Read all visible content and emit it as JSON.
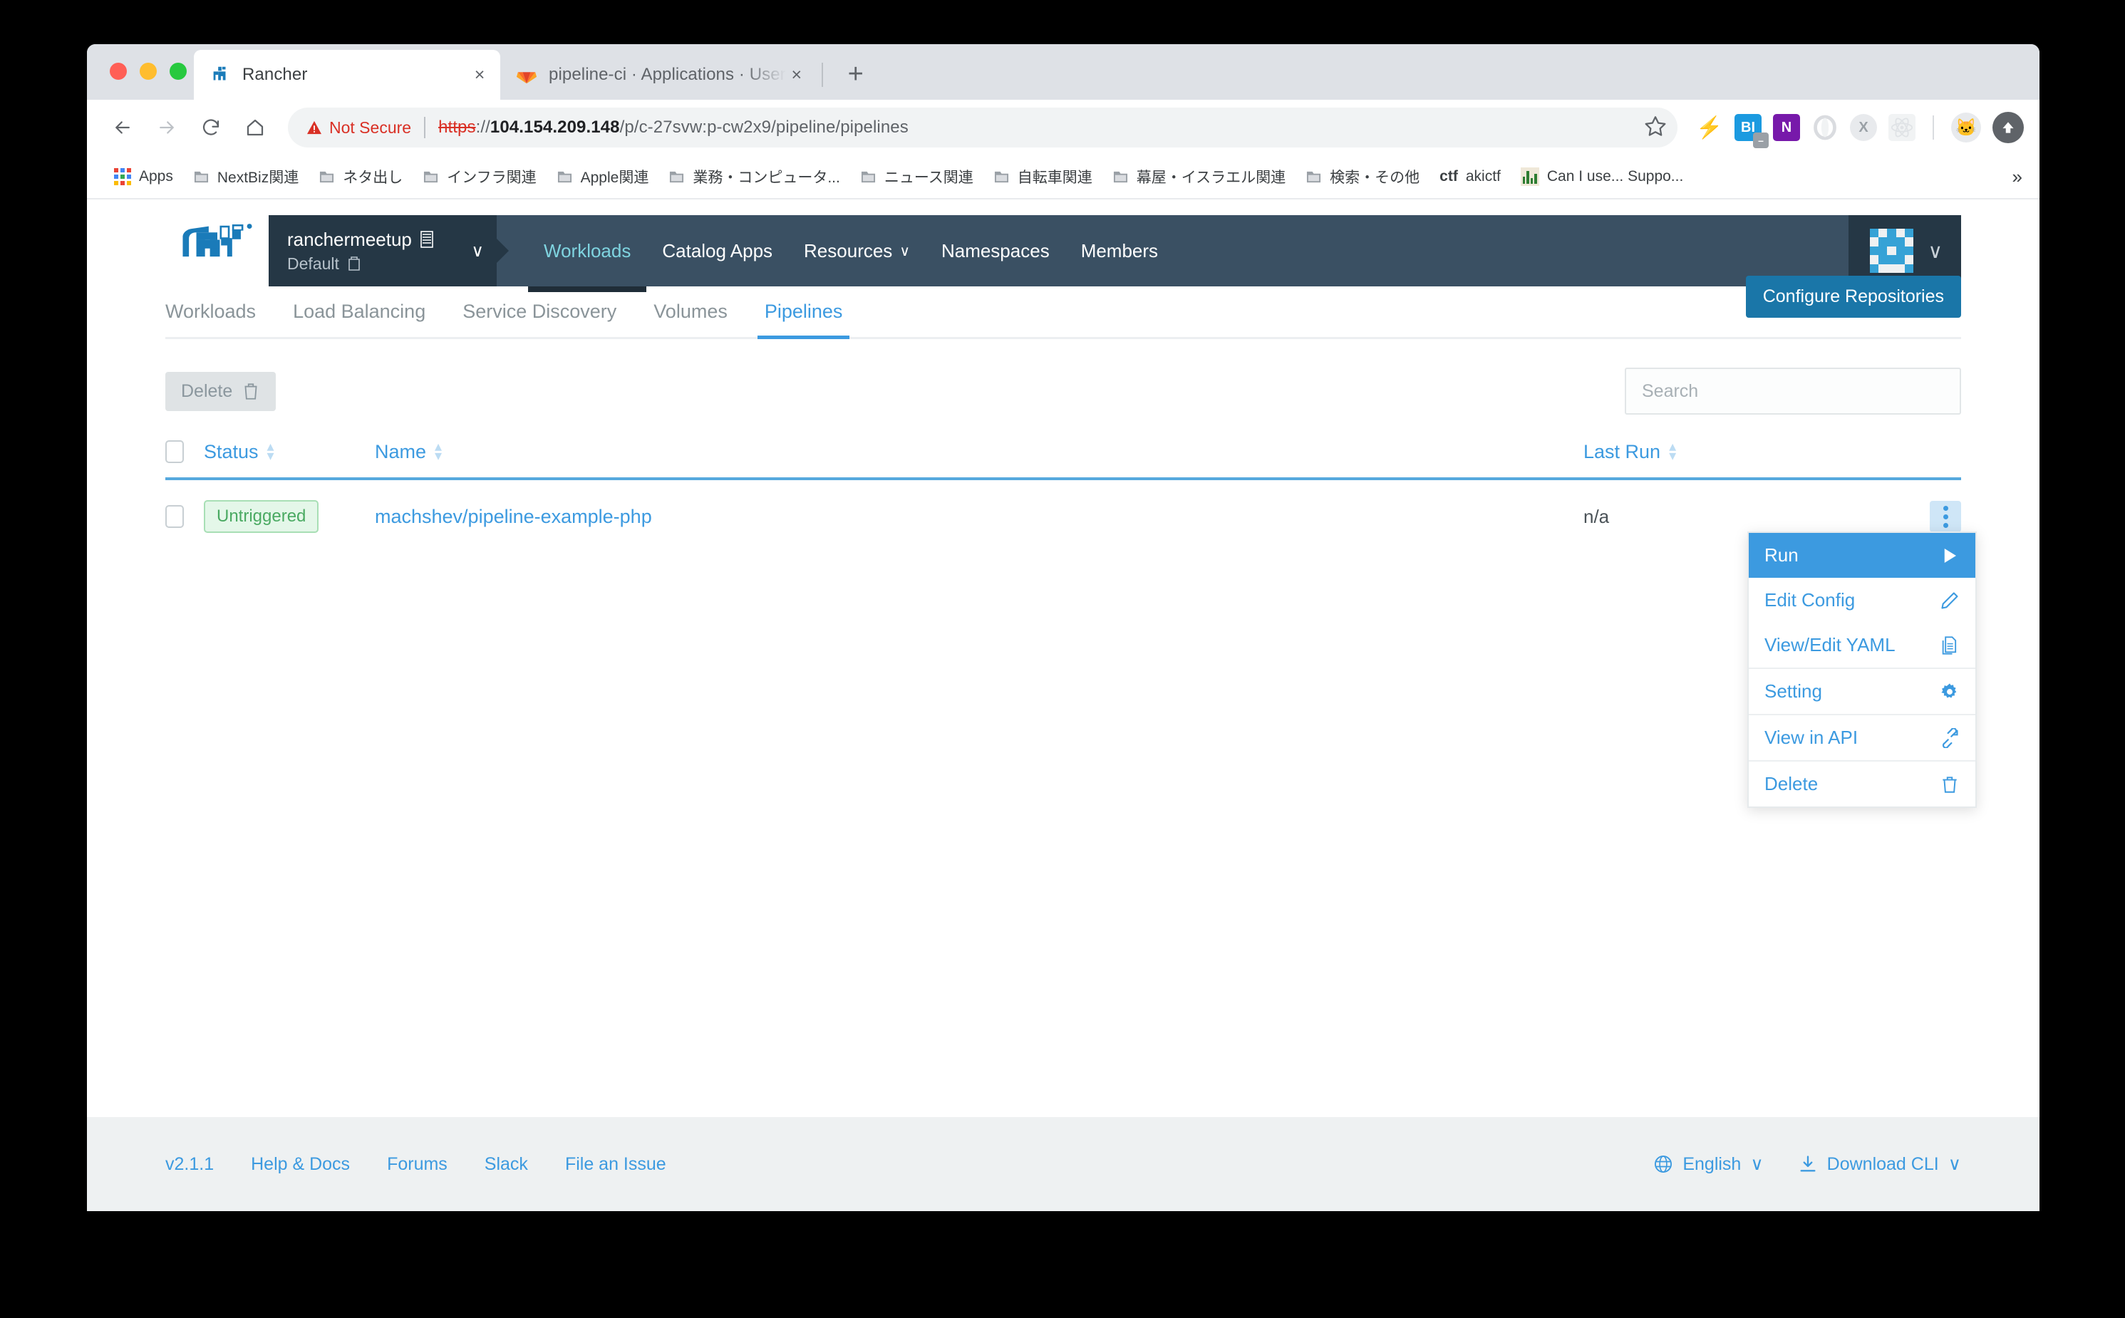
{
  "browser": {
    "tabs": [
      {
        "title": "Rancher",
        "favicon": "rancher-cow-icon",
        "active": true
      },
      {
        "title": "pipeline-ci · Applications · User",
        "favicon": "gitlab-fox-icon",
        "active": false
      }
    ],
    "new_tab_label": "+",
    "close_label": "×",
    "nav": {
      "back": "back-arrow",
      "forward": "forward-arrow",
      "reload": "reload-arrow",
      "home": "home-house"
    },
    "omnibox": {
      "security_label": "Not Secure",
      "scheme": "https",
      "separator": "://",
      "host": "104.154.209.148",
      "path": "/p/c-27svw:p-cw2x9/pipeline/pipelines",
      "star": "☆"
    },
    "extensions": [
      {
        "name": "lightning-bolt-icon",
        "glyph": "⚡"
      },
      {
        "name": "bi-extension-icon",
        "glyph": "BI"
      },
      {
        "name": "onenote-extension-icon",
        "glyph": "N"
      },
      {
        "name": "opera-ring-icon",
        "glyph": "O"
      },
      {
        "name": "x-extension-icon",
        "glyph": "X"
      },
      {
        "name": "react-devtools-icon",
        "glyph": "⚛"
      },
      {
        "name": "profile-avatar-icon",
        "glyph": "🐱"
      },
      {
        "name": "upload-arrow-icon",
        "glyph": "⬆"
      }
    ],
    "bookmarks": [
      {
        "label": "Apps",
        "icon": "apps-grid-icon"
      },
      {
        "label": "NextBiz関連",
        "icon": "folder-icon"
      },
      {
        "label": "ネタ出し",
        "icon": "folder-icon"
      },
      {
        "label": "インフラ関連",
        "icon": "folder-icon"
      },
      {
        "label": "Apple関連",
        "icon": "folder-icon"
      },
      {
        "label": "業務・コンピュータ...",
        "icon": "folder-icon"
      },
      {
        "label": "ニュース関連",
        "icon": "folder-icon"
      },
      {
        "label": "自転車関連",
        "icon": "folder-icon"
      },
      {
        "label": "幕屋・イスラエル関連",
        "icon": "folder-icon"
      },
      {
        "label": "検索・その他",
        "icon": "folder-icon"
      },
      {
        "label": "akictf",
        "icon": "ctf-text-icon"
      },
      {
        "label": "Can I use... Suppo...",
        "icon": "caniuse-chart-icon"
      }
    ],
    "bookmarks_overflow": "»"
  },
  "rancher": {
    "logo": "rancher-cow-logo",
    "project_picker": {
      "cluster": "ranchermeetup",
      "cluster_icon": "cluster-icon",
      "project": "Default",
      "project_icon": "project-folder-icon",
      "caret": "∨"
    },
    "nav_links": [
      {
        "label": "Workloads",
        "active": true,
        "has_caret": false
      },
      {
        "label": "Catalog Apps",
        "active": false,
        "has_caret": false
      },
      {
        "label": "Resources",
        "active": false,
        "has_caret": true
      },
      {
        "label": "Namespaces",
        "active": false,
        "has_caret": false
      },
      {
        "label": "Members",
        "active": false,
        "has_caret": false
      }
    ],
    "user_menu": {
      "avatar": "identicon-avatar",
      "caret": "∨"
    },
    "subtabs": [
      {
        "label": "Workloads",
        "active": false
      },
      {
        "label": "Load Balancing",
        "active": false
      },
      {
        "label": "Service Discovery",
        "active": false
      },
      {
        "label": "Volumes",
        "active": false
      },
      {
        "label": "Pipelines",
        "active": true
      }
    ],
    "configure_button": "Configure Repositories",
    "toolbar": {
      "delete_label": "Delete",
      "delete_icon": "trash-icon"
    },
    "search": {
      "placeholder": "Search",
      "value": ""
    },
    "table": {
      "columns": [
        {
          "label": "Status",
          "sortable": true
        },
        {
          "label": "Name",
          "sortable": true
        },
        {
          "label": "Last Run",
          "sortable": true
        }
      ],
      "sort_glyph": "▴▾",
      "rows": [
        {
          "status": "Untriggered",
          "name": "machshev/pipeline-example-php",
          "last_run": "n/a",
          "kebab": "kebab-menu-icon"
        }
      ]
    },
    "context_menu": [
      {
        "label": "Run",
        "icon": "play-icon",
        "glyph": "▶",
        "highlight": true,
        "separator": false
      },
      {
        "label": "Edit Config",
        "icon": "pencil-icon",
        "glyph": "✏",
        "highlight": false,
        "separator": false
      },
      {
        "label": "View/Edit YAML",
        "icon": "document-icon",
        "glyph": "🗎",
        "highlight": false,
        "separator": false
      },
      {
        "label": "Setting",
        "icon": "gear-icon",
        "glyph": "⚙",
        "highlight": false,
        "separator": true
      },
      {
        "label": "View in API",
        "icon": "link-external-icon",
        "glyph": "🔗",
        "highlight": false,
        "separator": true
      },
      {
        "label": "Delete",
        "icon": "trash-icon",
        "glyph": "🗑",
        "highlight": false,
        "separator": true
      }
    ],
    "footer": {
      "version": "v2.1.1",
      "links": [
        "Help & Docs",
        "Forums",
        "Slack",
        "File an Issue"
      ],
      "language": {
        "label": "English",
        "icon": "globe-icon",
        "caret": "∨"
      },
      "download": {
        "label": "Download CLI",
        "icon": "download-icon",
        "caret": "∨"
      }
    }
  },
  "colors": {
    "accent_blue": "#3c9ae0",
    "header_dark": "#3a5063",
    "picker_dark": "#253745",
    "button_blue": "#1a76a8",
    "status_green": "#4aaa62",
    "not_secure_red": "#d93025"
  }
}
